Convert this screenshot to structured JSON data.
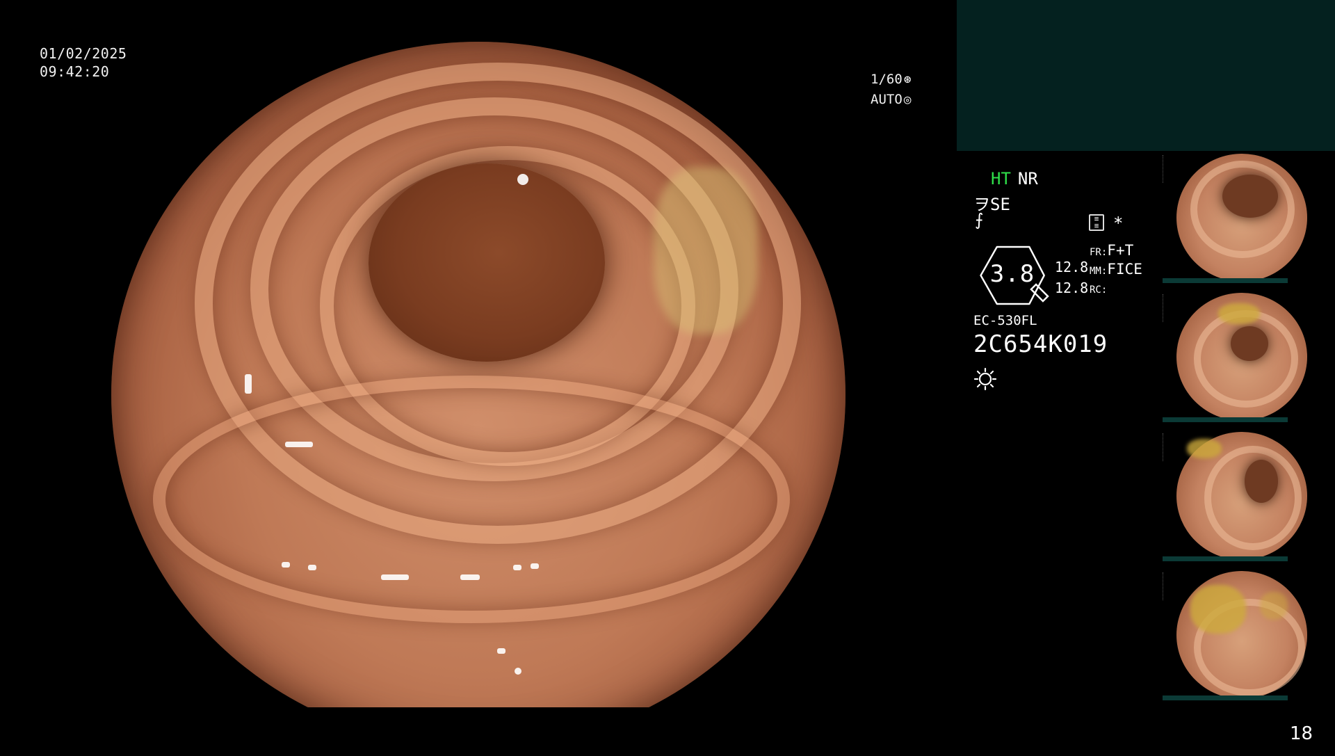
{
  "overlay": {
    "date": "01/02/2025",
    "time": "09:42:20",
    "shutter_speed": "1/60",
    "shutter_icon": "⊛",
    "iris_mode": "AUTO",
    "iris_icon": "◎"
  },
  "settings": {
    "ht_label": "HT",
    "nr_label": "NR",
    "se_label": "SE",
    "se_icon": "ヲ",
    "enhance_icon": "⨍",
    "asterisk": "*",
    "zoom_value": "3.8",
    "value_1": "12.8",
    "value_2": "12.8",
    "fr_label": "FR:",
    "fr_value": "F+T",
    "mm_label": "MM:",
    "mm_value": "FICE",
    "rc_label": "RC:",
    "rc_value": "",
    "scope_model": "EC-530FL",
    "scope_serial": "2C654K019"
  },
  "thumbnails": [
    {
      "name": "capture-1"
    },
    {
      "name": "capture-2"
    },
    {
      "name": "capture-3"
    },
    {
      "name": "capture-4"
    }
  ],
  "page_number": "18",
  "colors": {
    "accent_green": "#2fe04a",
    "sidebar_teal": "#04211f"
  }
}
